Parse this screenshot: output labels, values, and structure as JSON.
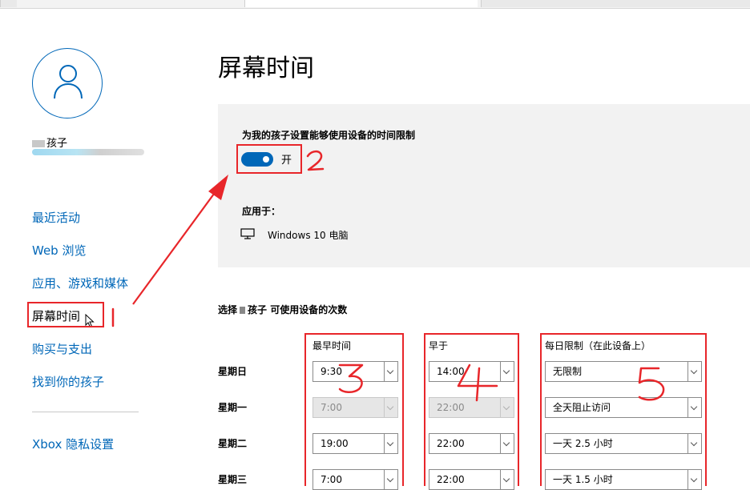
{
  "user": {
    "name_suffix": "孩子"
  },
  "nav": {
    "items": [
      {
        "label": "最近活动"
      },
      {
        "label": "Web 浏览"
      },
      {
        "label": "应用、游戏和媒体"
      },
      {
        "label": "屏幕时间"
      },
      {
        "label": "购买与支出"
      },
      {
        "label": "找到你的孩子"
      }
    ],
    "privacy": "Xbox 隐私设置"
  },
  "page": {
    "title": "屏幕时间"
  },
  "limits": {
    "title": "为我的孩子设置能够使用设备的时间限制",
    "toggle_state": "开",
    "toggle_on": true,
    "applies_to_label": "应用于：",
    "device": "Windows 10 电脑",
    "device_icon": "monitor-icon"
  },
  "schedule": {
    "prompt_before": "选择",
    "prompt_after": "孩子 可使用设备的次数",
    "headers": {
      "earliest": "最早时间",
      "before": "早于",
      "daily": "每日限制（在此设备上）"
    },
    "rows": [
      {
        "day": "星期日",
        "earliest": "9:30",
        "before": "14:00",
        "daily": "无限制",
        "disabled": false
      },
      {
        "day": "星期一",
        "earliest": "7:00",
        "before": "22:00",
        "daily": "全天阻止访问",
        "disabled": true
      },
      {
        "day": "星期二",
        "earliest": "19:00",
        "before": "22:00",
        "daily": "一天 2.5 小时",
        "disabled": false
      },
      {
        "day": "星期三",
        "earliest": "7:00",
        "before": "22:00",
        "daily": "一天 1.5 小时",
        "disabled": false
      }
    ]
  },
  "annotations": {
    "color": "#e8262a",
    "step_labels": [
      "1",
      "2",
      "3",
      "4",
      "5"
    ]
  }
}
